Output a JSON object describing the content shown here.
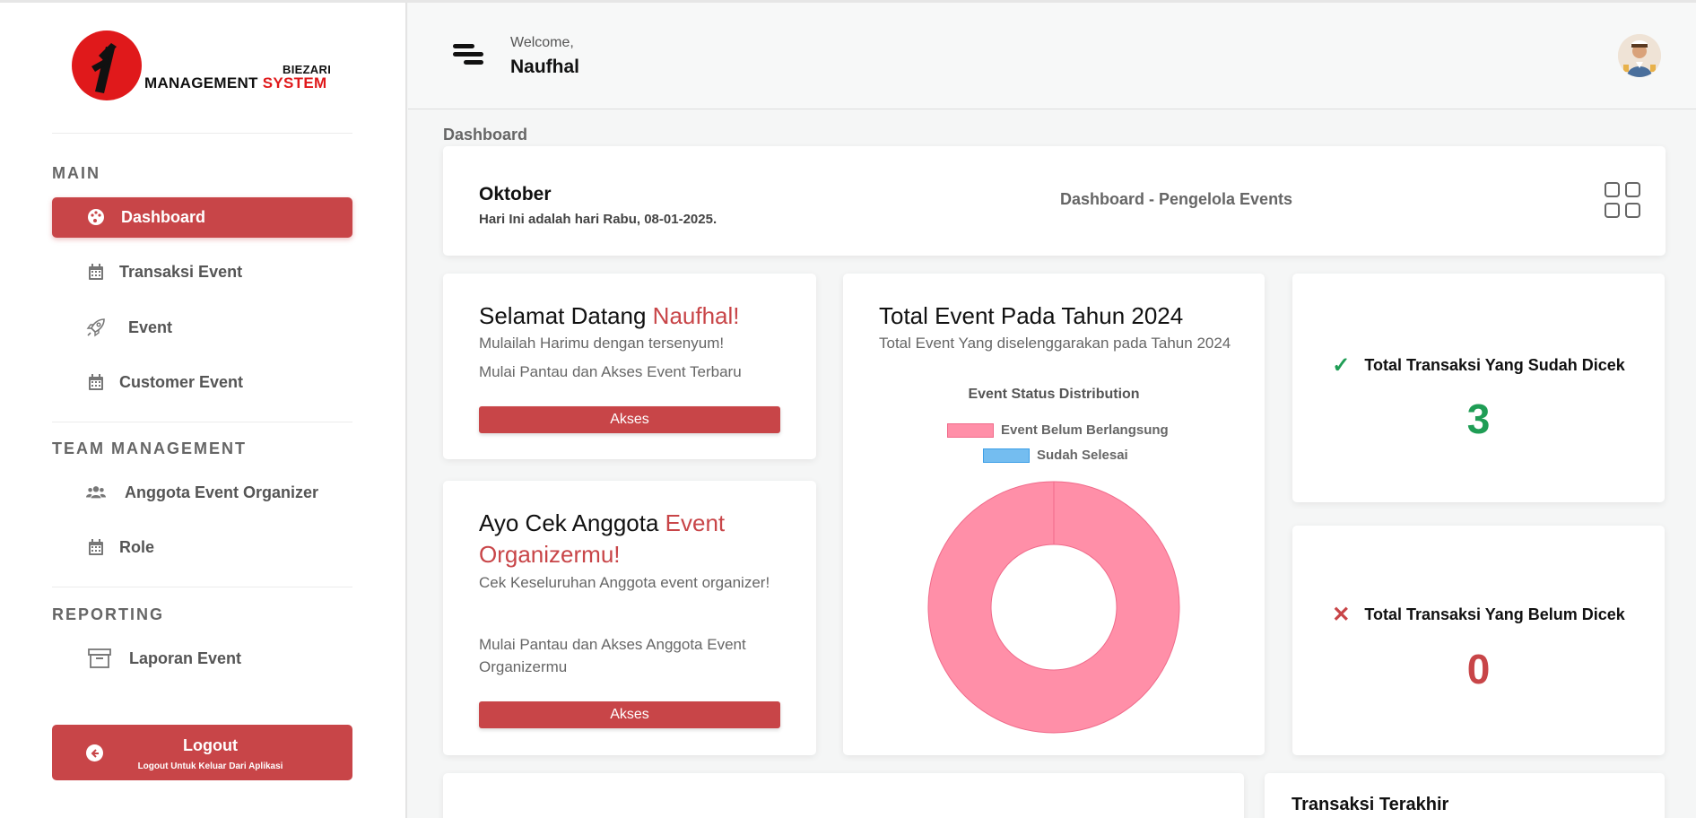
{
  "brand": {
    "small": "BIEZARI",
    "main_dark": "MANAGEMENT ",
    "main_red": "SYSTEM",
    "accent_color": "#c84548"
  },
  "sidebar": {
    "sections": [
      "MAIN",
      "TEAM MANAGEMENT",
      "REPORTING"
    ],
    "items": [
      {
        "label": "Dashboard",
        "icon": "palette-icon",
        "active": true
      },
      {
        "label": "Transaksi Event",
        "icon": "calendar-icon"
      },
      {
        "label": "Event",
        "icon": "rocket-icon"
      },
      {
        "label": "Customer Event",
        "icon": "calendar-icon"
      },
      {
        "label": "Anggota Event Organizer",
        "icon": "users-icon"
      },
      {
        "label": "Role",
        "icon": "calendar-icon"
      },
      {
        "label": "Laporan Event",
        "icon": "archive-icon"
      }
    ],
    "logout": {
      "label": "Logout",
      "sub": "Logout Untuk Keluar Dari Aplikasi"
    }
  },
  "header": {
    "welcome": "Welcome,",
    "user": "Naufhal"
  },
  "breadcrumb": "Dashboard",
  "banner": {
    "month": "Oktober",
    "today": "Hari Ini adalah hari Rabu, 08-01-2025.",
    "title": "Dashboard - Pengelola Events"
  },
  "welcome_card": {
    "title_prefix": "Selamat Datang ",
    "title_name": "Naufhal!",
    "line1": "Mulailah Harimu dengan tersenyum!",
    "line2": "Mulai Pantau dan Akses Event Terbaru",
    "button": "Akses"
  },
  "member_card": {
    "title_prefix": "Ayo Cek Anggota ",
    "title_red": "Event Organizermu!",
    "line1": "Cek Keseluruhan Anggota event organizer!",
    "line2": "Mulai Pantau dan Akses Anggota Event Organizermu",
    "button": "Akses"
  },
  "event_card": {
    "title": "Total Event Pada Tahun 2024",
    "subtitle": "Total Event Yang diselenggarakan pada Tahun 2024"
  },
  "chart_data": {
    "type": "pie",
    "title": "Event Status Distribution",
    "categories": [
      "Event Belum Berlangsung",
      "Sudah Selesai"
    ],
    "values": [
      1,
      0
    ],
    "colors": [
      "#ff8fa8",
      "#74bdf0"
    ],
    "donut": true,
    "legend": "top"
  },
  "stats": {
    "checked_label": "Total Transaksi Yang Sudah Dicek",
    "checked_value": "3",
    "unchecked_label": "Total Transaksi Yang Belum Dicek",
    "unchecked_value": "0",
    "green": "#1f9d55",
    "red": "#c84548"
  },
  "bottom": {
    "recent_title": "Transaksi Terakhir"
  }
}
